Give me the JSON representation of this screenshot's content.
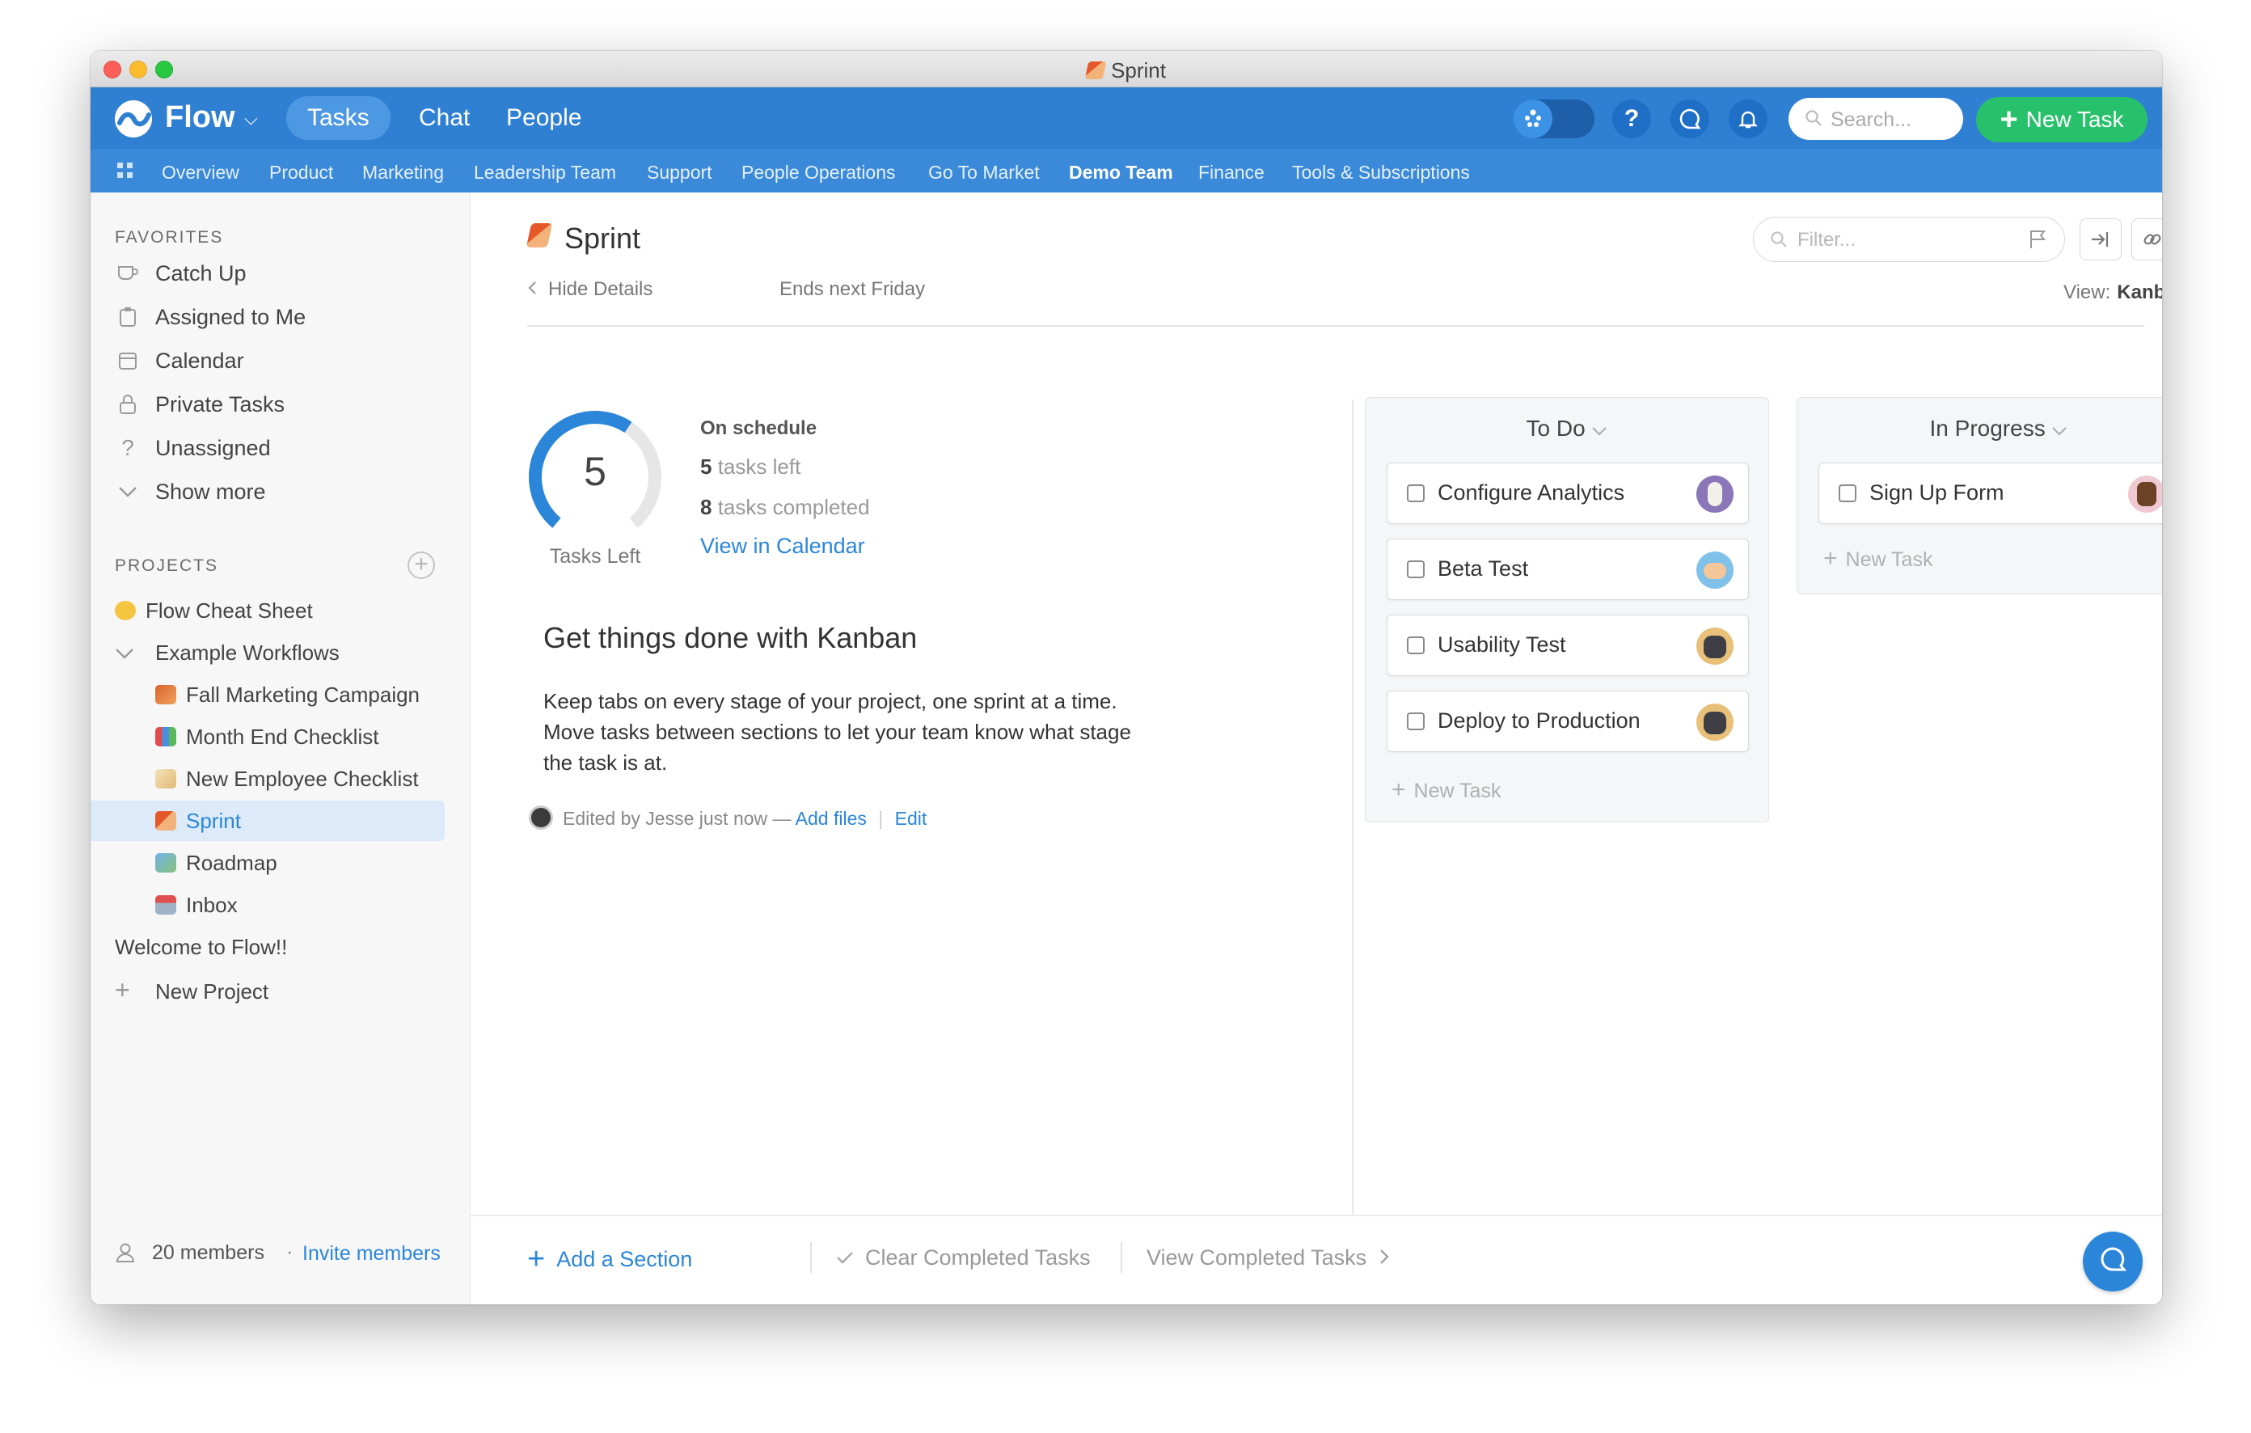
{
  "window": {
    "title": "Sprint"
  },
  "topnav": {
    "logo": "Flow",
    "tabs": [
      "Tasks",
      "Chat",
      "People"
    ],
    "search_placeholder": "Search...",
    "new_task": "New Task"
  },
  "projects_bar": [
    "Overview",
    "Product",
    "Marketing",
    "Leadership Team",
    "Support",
    "People Operations",
    "Go To Market",
    "Demo Team",
    "Finance",
    "Tools & Subscriptions"
  ],
  "sidebar": {
    "favorites_title": "FAVORITES",
    "favorites": [
      "Catch Up",
      "Assigned to Me",
      "Calendar",
      "Private Tasks",
      "Unassigned",
      "Show more"
    ],
    "projects_title": "PROJECTS",
    "projects": {
      "cheat": "Flow Cheat Sheet",
      "workflows": "Example Workflows",
      "children": [
        "Fall Marketing Campaign",
        "Month End Checklist",
        "New Employee Checklist",
        "Sprint",
        "Roadmap",
        "Inbox"
      ],
      "welcome": "Welcome to Flow!!",
      "new_project": "New Project"
    },
    "footer": {
      "members": "20 members",
      "invite": "Invite members"
    }
  },
  "header": {
    "title": "Sprint",
    "hide_details": "Hide Details",
    "ends": "Ends next Friday",
    "filter_placeholder": "Filter...",
    "view_label": "View:",
    "view_value": "Kanban"
  },
  "details": {
    "tasks_left_number": "5",
    "tasks_left_label": "Tasks Left",
    "progress_fraction": 0.38,
    "status": "On schedule",
    "left_count": "5",
    "left_text": "tasks left",
    "done_count": "8",
    "done_text": "tasks completed",
    "calendar_link": "View in Calendar",
    "heading": "Get things done with Kanban",
    "body_lines": [
      "Keep tabs on every stage of your project, one sprint at a time.",
      "Move tasks between sections to let your team know what stage",
      "the task is at."
    ],
    "edited": "Edited by Jesse just now —",
    "add_files": "Add files",
    "edit": "Edit"
  },
  "board": {
    "columns": [
      {
        "title": "To Do",
        "tasks": [
          "Configure Analytics",
          "Beta Test",
          "Usability Test",
          "Deploy to Production"
        ],
        "new_task": "New Task"
      },
      {
        "title": "In Progress",
        "tasks": [
          "Sign Up Form"
        ],
        "new_task": "New Task"
      }
    ]
  },
  "footerbar": {
    "add_section": "Add a Section",
    "clear_completed": "Clear Completed Tasks",
    "view_completed": "View Completed Tasks"
  },
  "colors": {
    "brand": "#2f80d3",
    "green": "#27c16b",
    "link": "#2b86d9"
  }
}
